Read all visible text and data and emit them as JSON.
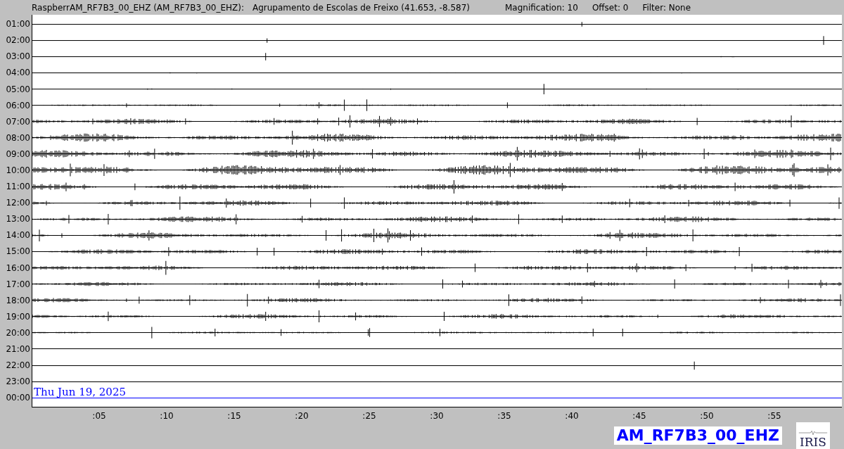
{
  "header": {
    "station": "RaspberrAM_RF7B3_00_EHZ (AM_RF7B3_00_EHZ):",
    "location": "Agrupamento de Escolas de Freixo (41.653, -8.587)",
    "magnification": "Magnification: 10",
    "offset": "Offset: 0",
    "filter": "Filter: None"
  },
  "rows": [
    {
      "label": "01:00",
      "color": "#000000"
    },
    {
      "label": "02:00",
      "color": "#000000"
    },
    {
      "label": "03:00",
      "color": "#000000"
    },
    {
      "label": "04:00",
      "color": "#000000"
    },
    {
      "label": "05:00",
      "color": "#000000"
    },
    {
      "label": "06:00",
      "color": "#000000"
    },
    {
      "label": "07:00",
      "color": "#000000"
    },
    {
      "label": "08:00",
      "color": "#000000"
    },
    {
      "label": "09:00",
      "color": "#000000"
    },
    {
      "label": "10:00",
      "color": "#000000"
    },
    {
      "label": "11:00",
      "color": "#000000"
    },
    {
      "label": "12:00",
      "color": "#000000"
    },
    {
      "label": "13:00",
      "color": "#000000"
    },
    {
      "label": "14:00",
      "color": "#000000"
    },
    {
      "label": "15:00",
      "color": "#000000"
    },
    {
      "label": "16:00",
      "color": "#000000"
    },
    {
      "label": "17:00",
      "color": "#000000"
    },
    {
      "label": "18:00",
      "color": "#000000"
    },
    {
      "label": "19:00",
      "color": "#000000"
    },
    {
      "label": "20:00",
      "color": "#000000"
    },
    {
      "label": "21:00",
      "color": "#000000"
    },
    {
      "label": "22:00",
      "color": "#000000"
    },
    {
      "label": "23:00",
      "color": "#000000"
    },
    {
      "label": "00:00",
      "color": "#0000ff"
    }
  ],
  "date": "Thu Jun 19, 2025",
  "minute_ticks": [
    ":05",
    ":10",
    ":15",
    ":20",
    ":25",
    ":30",
    ":35",
    ":40",
    ":45",
    ":50",
    ":55"
  ],
  "channel_label": "AM_RF7B3_00_EHZ",
  "logo_text": "IRIS"
}
